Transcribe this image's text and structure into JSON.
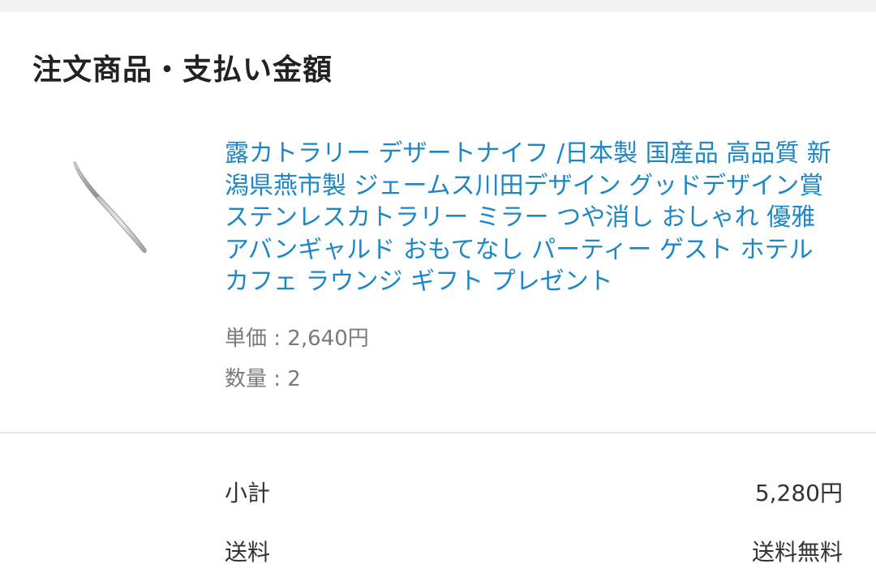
{
  "section": {
    "title": "注文商品・支払い金額"
  },
  "product": {
    "image_icon": "dessert-knife-image",
    "title": "露カトラリー デザートナイフ /日本製 国産品 高品質 新潟県燕市製 ジェームス川田デザイン グッドデザイン賞 ステンレスカトラリー ミラー つや消し おしゃれ 優雅 アバンギャルド おもてなし パーティー ゲスト ホテル カフェ ラウンジ ギフト プレゼント",
    "unit_price_label": "単価 : ",
    "unit_price": "2,640円",
    "quantity_label": "数量 : ",
    "quantity": "2",
    "link_color": "#1d87c5"
  },
  "summary": {
    "subtotal_label": "小計",
    "subtotal_value": "5,280円",
    "shipping_label": "送料",
    "shipping_value": "送料無料"
  }
}
